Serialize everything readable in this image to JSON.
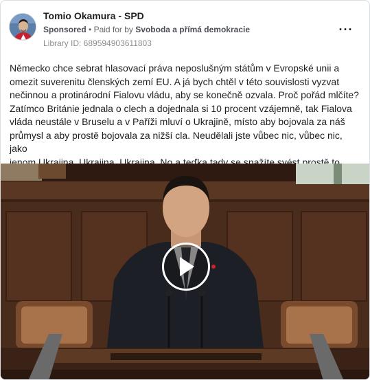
{
  "post": {
    "page_name": "Tomio Okamura - SPD",
    "sponsored_label": "Sponsored",
    "separator": "•",
    "paid_for_label": "Paid for by",
    "funder_name": "Svoboda a přímá demokracie",
    "library_id": "Library ID: 689594903611803",
    "more_icon": "more-horizontal-icon",
    "text_lines": [
      "Německo chce sebrat hlasovací práva neposlušným státům v Evropské unii a",
      "omezit suverenitu členských zemí EU. A já bych chtěl v této souvislosti vyzvat",
      "nečinnou a protinárodní Fialovu vládu, aby se konečně ozvala. Proč pořád mlčíte?",
      "Zatímco Británie jednala o clech a dojednala si 10 procent vzájemně, tak Fialova",
      "vláda neustále v Bruselu a v Paříži mluví o Ukrajině, místo aby bojovala za náš",
      "průmysl a aby prostě bojovala za nižší cla. Neudělali jste vůbec nic, vůbec nic, jako",
      "jenom Ukrajina, Ukrajina, Ukrajina. No a teďka tady se snažíte svést prostě to, co..."
    ]
  },
  "video": {
    "play_icon": "play-icon"
  }
}
